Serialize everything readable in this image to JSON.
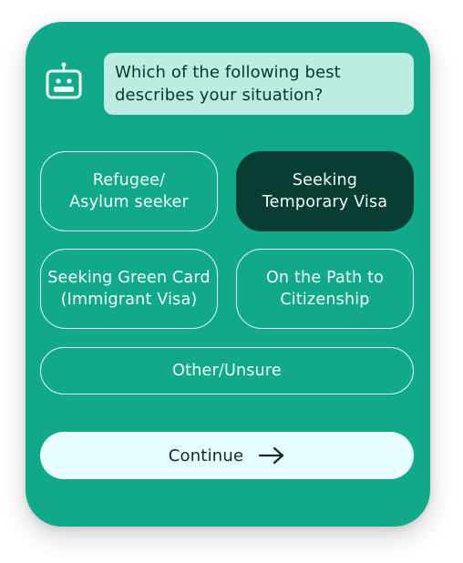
{
  "question": {
    "text": "Which of the following best describes your situation?",
    "icon": "robot-icon"
  },
  "options": [
    {
      "label": "Refugee/\nAsylum seeker",
      "selected": false
    },
    {
      "label": "Seeking\nTemporary Visa",
      "selected": true
    },
    {
      "label": "Seeking Green Card\n(Immigrant Visa)",
      "selected": false
    },
    {
      "label": "On the Path to\nCitizenship",
      "selected": false
    },
    {
      "label": "Other/Unsure",
      "selected": false
    }
  ],
  "continue_button": {
    "label": "Continue",
    "icon": "arrow-right-icon"
  },
  "colors": {
    "card_background": "#12a88a",
    "bubble_background": "#bdece2",
    "selected_option": "#073d32",
    "button_background": "#e8fdfd"
  }
}
